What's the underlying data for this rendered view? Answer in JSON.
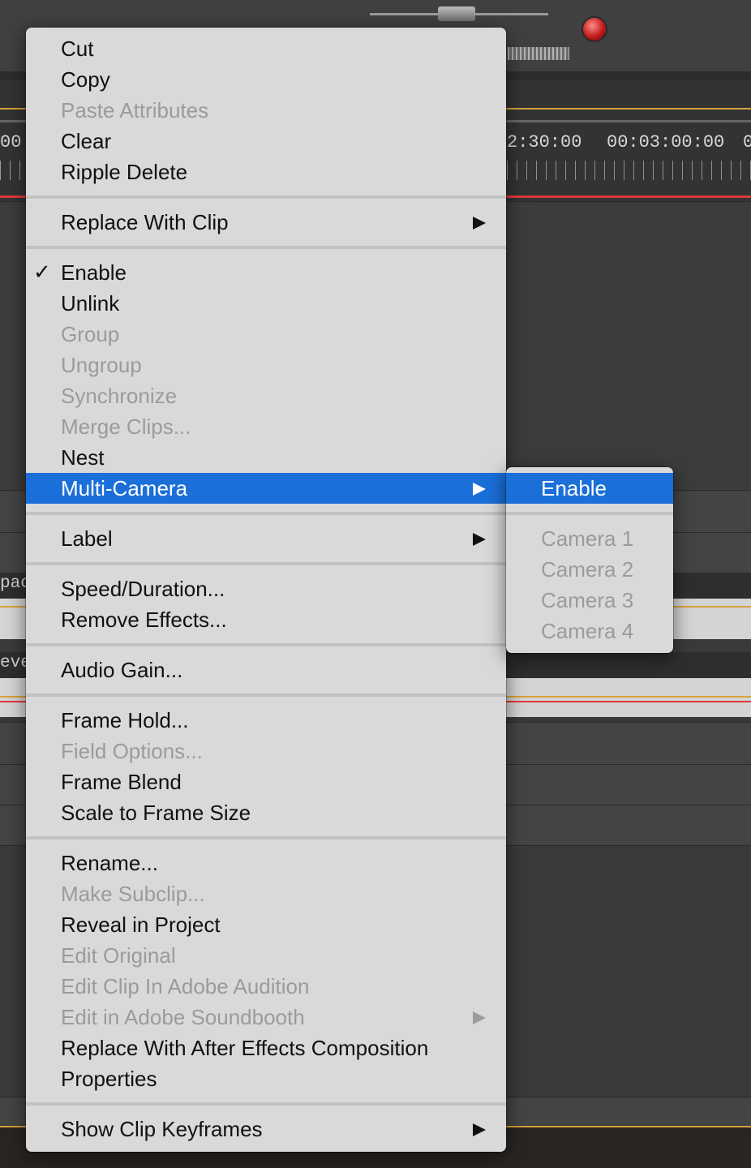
{
  "background": {
    "timecodes": [
      "00",
      "2:30:00",
      "00:03:00:00",
      "0"
    ],
    "track_labels": [
      "pac",
      "evel"
    ]
  },
  "menu": {
    "items": [
      {
        "label": "Cut",
        "enabled": true
      },
      {
        "label": "Copy",
        "enabled": true
      },
      {
        "label": "Paste Attributes",
        "enabled": false
      },
      {
        "label": "Clear",
        "enabled": true
      },
      {
        "label": "Ripple Delete",
        "enabled": true
      },
      {
        "label": "Replace With Clip",
        "enabled": true,
        "submenu": true
      },
      {
        "label": "Enable",
        "enabled": true,
        "checked": true
      },
      {
        "label": "Unlink",
        "enabled": true
      },
      {
        "label": "Group",
        "enabled": false
      },
      {
        "label": "Ungroup",
        "enabled": false
      },
      {
        "label": "Synchronize",
        "enabled": false
      },
      {
        "label": "Merge Clips...",
        "enabled": false
      },
      {
        "label": "Nest",
        "enabled": true
      },
      {
        "label": "Multi-Camera",
        "enabled": true,
        "submenu": true,
        "highlighted": true
      },
      {
        "label": "Label",
        "enabled": true,
        "submenu": true
      },
      {
        "label": "Speed/Duration...",
        "enabled": true
      },
      {
        "label": "Remove Effects...",
        "enabled": true
      },
      {
        "label": "Audio Gain...",
        "enabled": true
      },
      {
        "label": "Frame Hold...",
        "enabled": true
      },
      {
        "label": "Field Options...",
        "enabled": false
      },
      {
        "label": "Frame Blend",
        "enabled": true
      },
      {
        "label": "Scale to Frame Size",
        "enabled": true
      },
      {
        "label": "Rename...",
        "enabled": true
      },
      {
        "label": "Make Subclip...",
        "enabled": false
      },
      {
        "label": "Reveal in Project",
        "enabled": true
      },
      {
        "label": "Edit Original",
        "enabled": false
      },
      {
        "label": "Edit Clip In Adobe Audition",
        "enabled": false
      },
      {
        "label": "Edit in Adobe Soundbooth",
        "enabled": false,
        "submenu": true
      },
      {
        "label": "Replace With After Effects Composition",
        "enabled": true
      },
      {
        "label": "Properties",
        "enabled": true
      },
      {
        "label": "Show Clip Keyframes",
        "enabled": true,
        "submenu": true
      }
    ],
    "checkmark": "✓"
  },
  "submenu": {
    "items": [
      {
        "label": "Enable",
        "enabled": true,
        "highlighted": true
      },
      {
        "label": "Camera 1",
        "enabled": false
      },
      {
        "label": "Camera 2",
        "enabled": false
      },
      {
        "label": "Camera 3",
        "enabled": false
      },
      {
        "label": "Camera 4",
        "enabled": false
      }
    ]
  },
  "colors": {
    "highlight": "#1a6fd9",
    "menu_bg": "#d9d9d9",
    "disabled_text": "#9b9b9b",
    "timeline_orange": "#d8a23b",
    "timeline_red": "#e0393a"
  }
}
